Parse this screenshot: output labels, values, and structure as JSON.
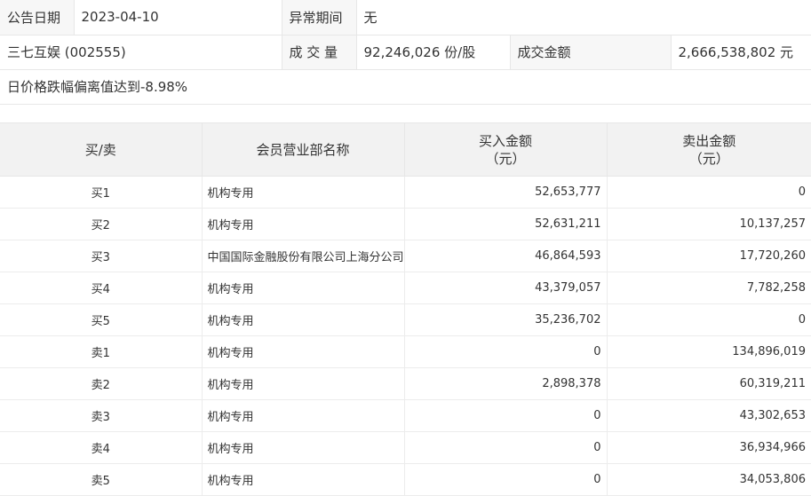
{
  "info": {
    "announce_date_label": "公告日期",
    "announce_date": "2023-04-10",
    "abnormal_period_label": "异常期间",
    "abnormal_period": "无",
    "stock": "三七互娱 (002555)",
    "volume_label": "成 交 量",
    "volume": "92,246,026 份/股",
    "turnover_label": "成交金额",
    "turnover": "2,666,538,802 元",
    "reason": "日价格跌幅偏离值达到-8.98%"
  },
  "columns": {
    "side": "买/卖",
    "broker": "会员营业部名称",
    "buy_amount": "买入金额",
    "buy_unit": "（元）",
    "sell_amount": "卖出金额",
    "sell_unit": "（元）"
  },
  "rows": [
    {
      "side": "买1",
      "broker": "机构专用",
      "buy": "52,653,777",
      "sell": "0"
    },
    {
      "side": "买2",
      "broker": "机构专用",
      "buy": "52,631,211",
      "sell": "10,137,257"
    },
    {
      "side": "买3",
      "broker": "中国国际金融股份有限公司上海分公司",
      "buy": "46,864,593",
      "sell": "17,720,260"
    },
    {
      "side": "买4",
      "broker": "机构专用",
      "buy": "43,379,057",
      "sell": "7,782,258"
    },
    {
      "side": "买5",
      "broker": "机构专用",
      "buy": "35,236,702",
      "sell": "0"
    },
    {
      "side": "卖1",
      "broker": "机构专用",
      "buy": "0",
      "sell": "134,896,019"
    },
    {
      "side": "卖2",
      "broker": "机构专用",
      "buy": "2,898,378",
      "sell": "60,319,211"
    },
    {
      "side": "卖3",
      "broker": "机构专用",
      "buy": "0",
      "sell": "43,302,653"
    },
    {
      "side": "卖4",
      "broker": "机构专用",
      "buy": "0",
      "sell": "36,934,966"
    },
    {
      "side": "卖5",
      "broker": "机构专用",
      "buy": "0",
      "sell": "34,053,806"
    }
  ]
}
